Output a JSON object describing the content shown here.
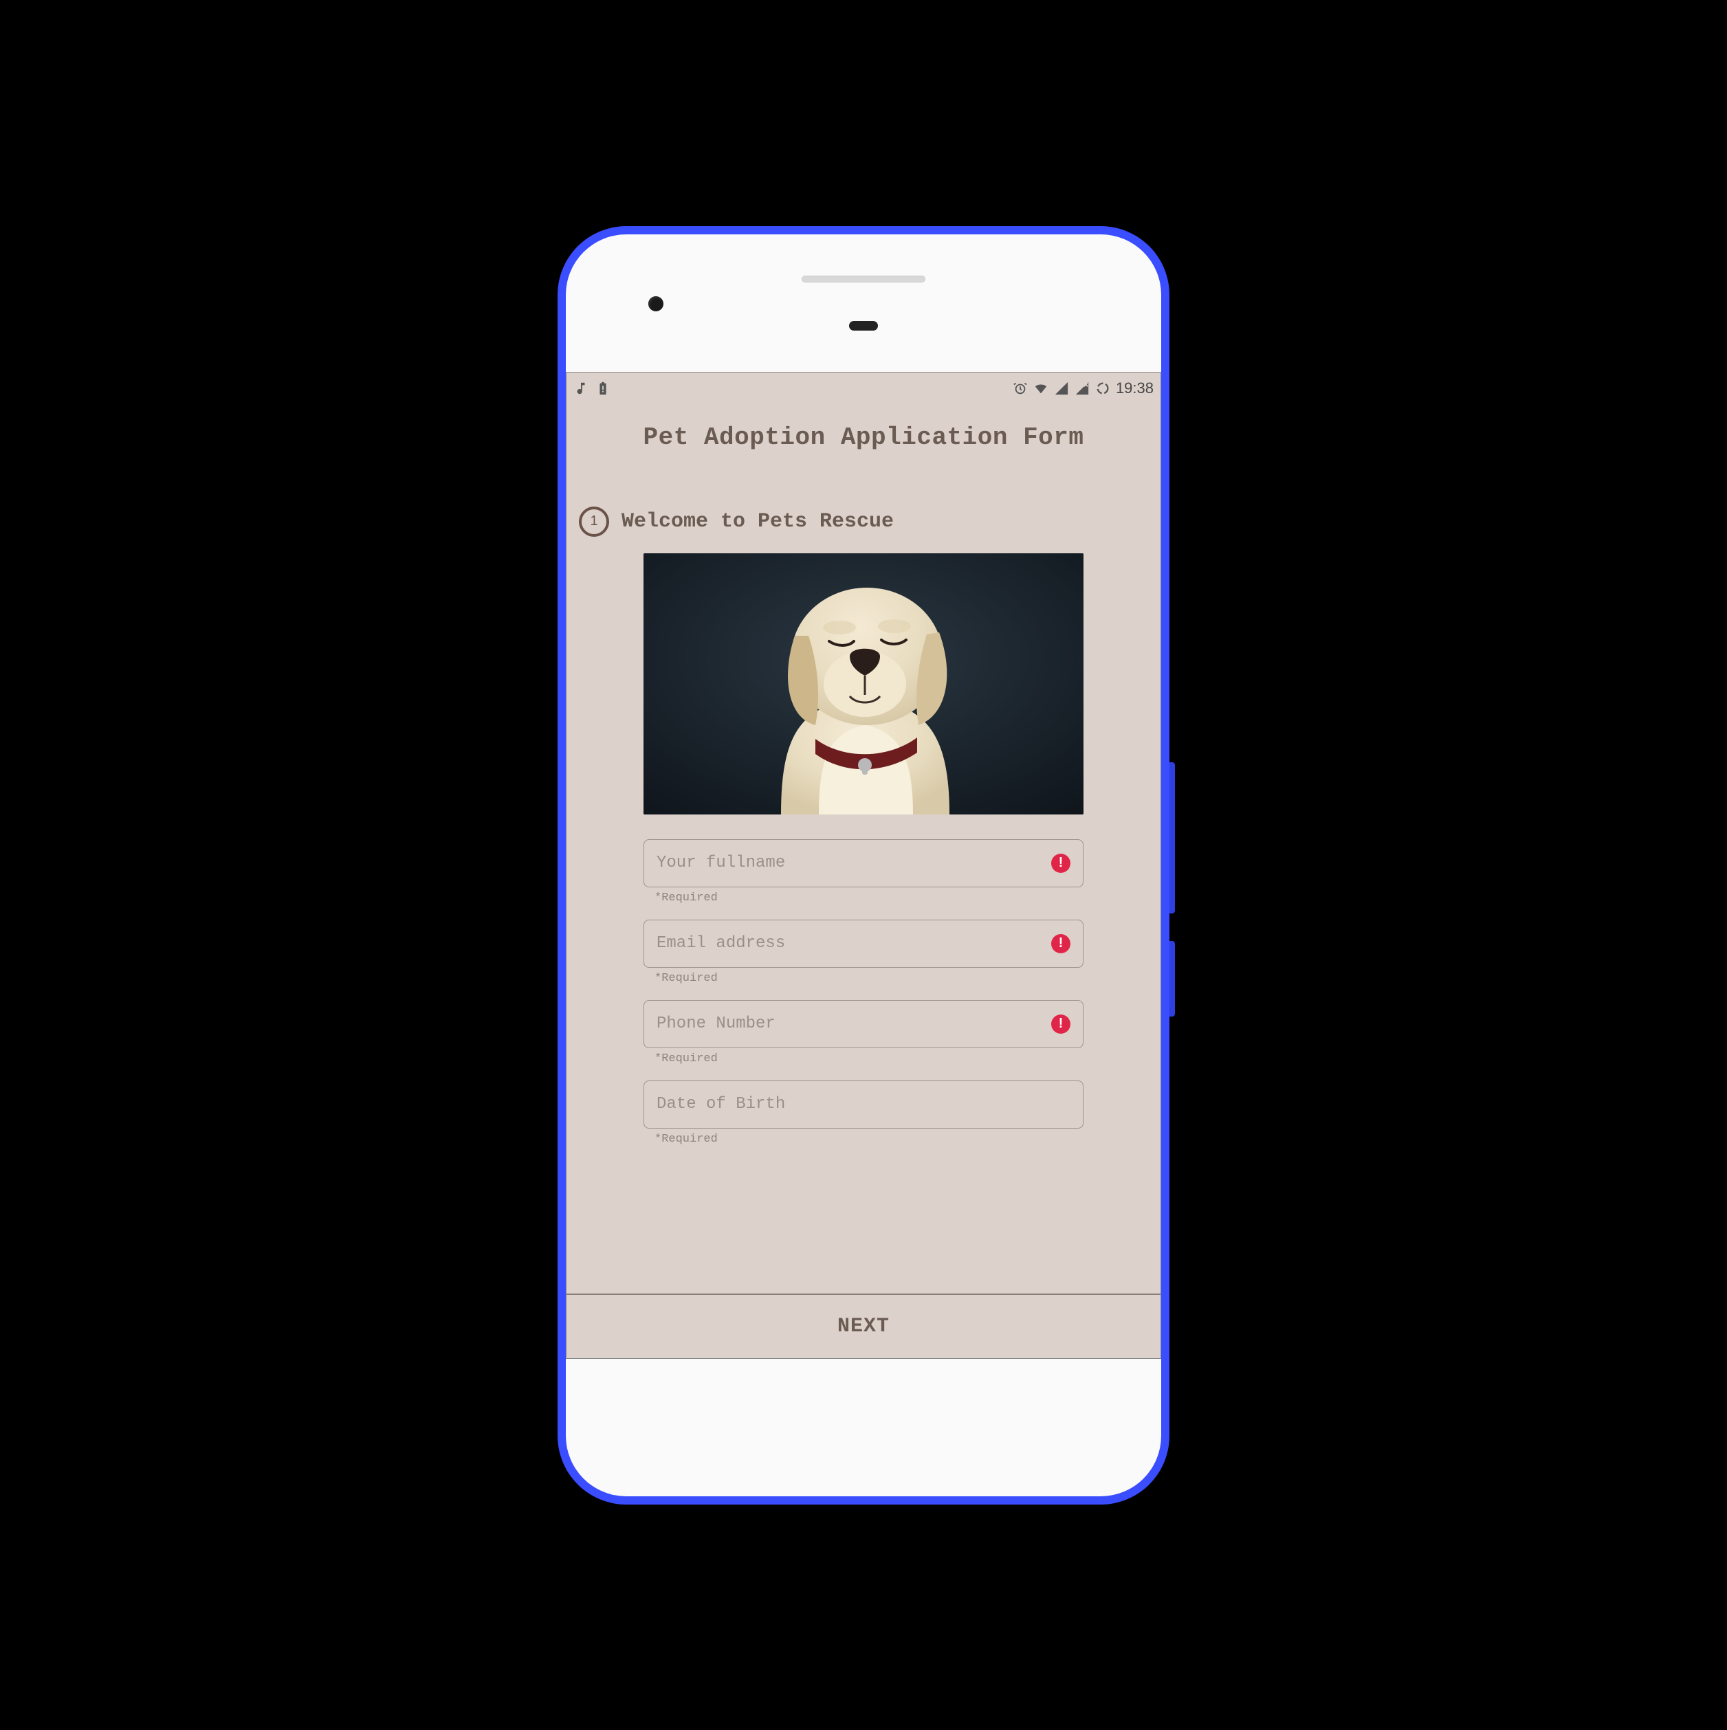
{
  "statusbar": {
    "clock": "19:38"
  },
  "form": {
    "title": "Pet Adoption Application Form",
    "step": {
      "number": "1",
      "label": "Welcome to Pets Rescue"
    },
    "fields": {
      "fullname": {
        "placeholder": "Your fullname",
        "helper": "*Required",
        "error": true
      },
      "email": {
        "placeholder": "Email address",
        "helper": "*Required",
        "error": true
      },
      "phone": {
        "placeholder": "Phone Number",
        "helper": "*Required",
        "error": true
      },
      "dob": {
        "placeholder": "Date of Birth",
        "helper": "*Required",
        "error": false
      }
    },
    "next_label": "NEXT"
  },
  "colors": {
    "background": "#ddd1cb",
    "text": "#6a5c53",
    "accent": "#6a5248",
    "error": "#e02648"
  }
}
